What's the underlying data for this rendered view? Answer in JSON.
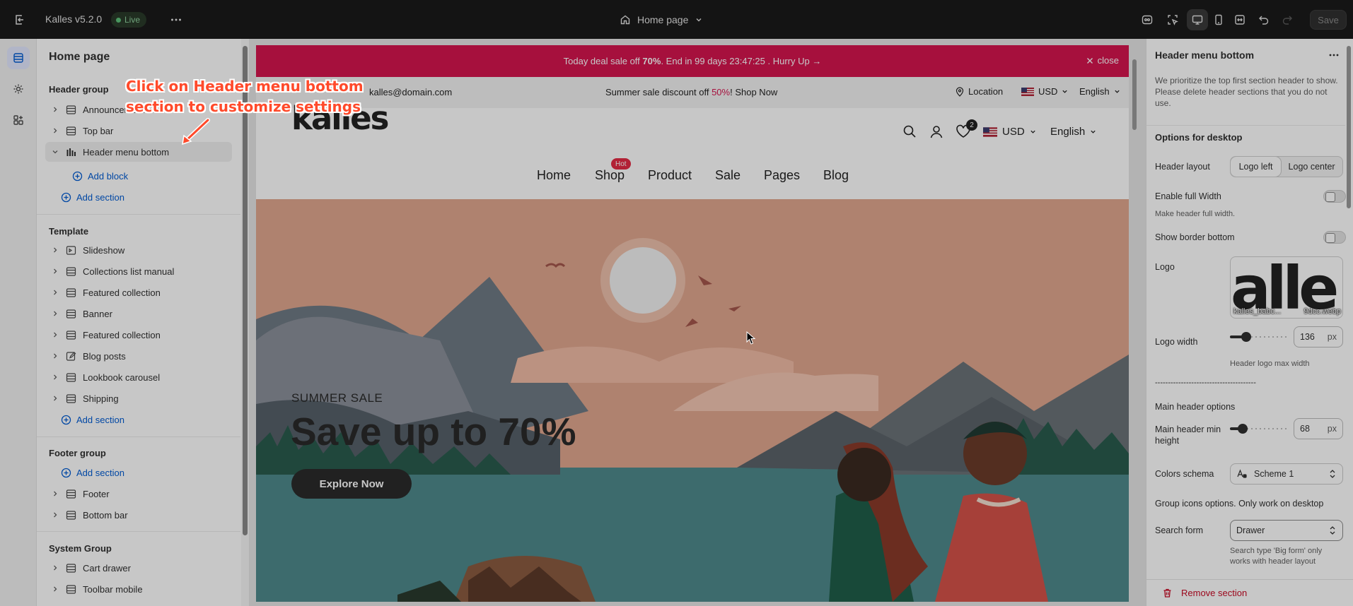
{
  "topbar": {
    "app_name": "Kalles v5.2.0",
    "live_label": "Live",
    "page_select": "Home page",
    "save_label": "Save"
  },
  "sections": {
    "title": "Home page",
    "header_group": {
      "title": "Header group",
      "items": [
        {
          "label": "Announcement bar"
        },
        {
          "label": "Top bar"
        },
        {
          "label": "Header menu bottom"
        }
      ],
      "add_block": "Add block",
      "add_section": "Add section"
    },
    "template": {
      "title": "Template",
      "items": [
        {
          "label": "Slideshow"
        },
        {
          "label": "Collections list manual"
        },
        {
          "label": "Featured collection"
        },
        {
          "label": "Banner"
        },
        {
          "label": "Featured collection"
        },
        {
          "label": "Blog posts"
        },
        {
          "label": "Lookbook carousel"
        },
        {
          "label": "Shipping"
        }
      ],
      "add_section": "Add section"
    },
    "footer_group": {
      "title": "Footer group",
      "add_section": "Add section",
      "items": [
        {
          "label": "Footer"
        },
        {
          "label": "Bottom bar"
        }
      ]
    },
    "system_group": {
      "title": "System Group",
      "items": [
        {
          "label": "Cart drawer"
        },
        {
          "label": "Toolbar mobile"
        }
      ]
    }
  },
  "callout": {
    "line1": "Click on Header menu bottom",
    "line2": "section to customize settings"
  },
  "preview": {
    "announcement": {
      "pre": "Today deal sale off ",
      "bold": "70%",
      "post": ". End in 99 days 23:47:25 .  Hurry Up →",
      "close_label": "close"
    },
    "topinfo": {
      "email": "kalles@domain.com",
      "promo_pre": "Summer sale discount off ",
      "promo_pct": "50%",
      "promo_post": "! ",
      "promo_link": "Shop Now",
      "location": "Location",
      "currency": "USD",
      "language": "English"
    },
    "header": {
      "logo": "kalles",
      "cart_count": "2",
      "currency": "USD",
      "language": "English"
    },
    "nav": {
      "items": [
        "Home",
        "Shop",
        "Product",
        "Sale",
        "Pages",
        "Blog"
      ],
      "hot_badge": "Hot"
    },
    "hero": {
      "subtitle": "SUMMER SALE",
      "title": "Save up to 70%",
      "button": "Explore Now"
    }
  },
  "settings": {
    "title": "Header menu bottom",
    "intro": "We prioritize the top first section header to show. Please delete header sections that you do not use.",
    "desktop_heading": "Options for desktop",
    "header_layout": {
      "label": "Header layout",
      "options": [
        "Logo left",
        "Logo center"
      ],
      "selected": "Logo left"
    },
    "full_width": {
      "label": "Enable full Width",
      "help": "Make header full width.",
      "enabled": false
    },
    "border_bottom": {
      "label": "Show border bottom",
      "enabled": false
    },
    "logo": {
      "label": "Logo",
      "file_a": "kalles_babc...",
      "file_b": "9dcc.webp",
      "preview_text": "alle"
    },
    "logo_width": {
      "label": "Logo width",
      "value": "136",
      "unit": "px",
      "help": "Header logo max width",
      "fraction": 0.24
    },
    "divider": "---------------------------------------",
    "main_header_options": "Main header options",
    "main_header_min_height": {
      "label": "Main header min height",
      "value": "68",
      "unit": "px",
      "fraction": 0.16
    },
    "colors_schema": {
      "label": "Colors schema",
      "value": "Scheme 1"
    },
    "group_icons": "Group icons options. Only work on desktop",
    "search_form": {
      "label": "Search form",
      "value": "Drawer",
      "help": "Search type 'Big form' only works with header layout"
    },
    "remove_label": "Remove section"
  },
  "colors": {
    "announcement_bg": "#d5154f",
    "accent_link": "#005bd3",
    "danger": "#c70a24",
    "callout": "#ff4a2b"
  }
}
